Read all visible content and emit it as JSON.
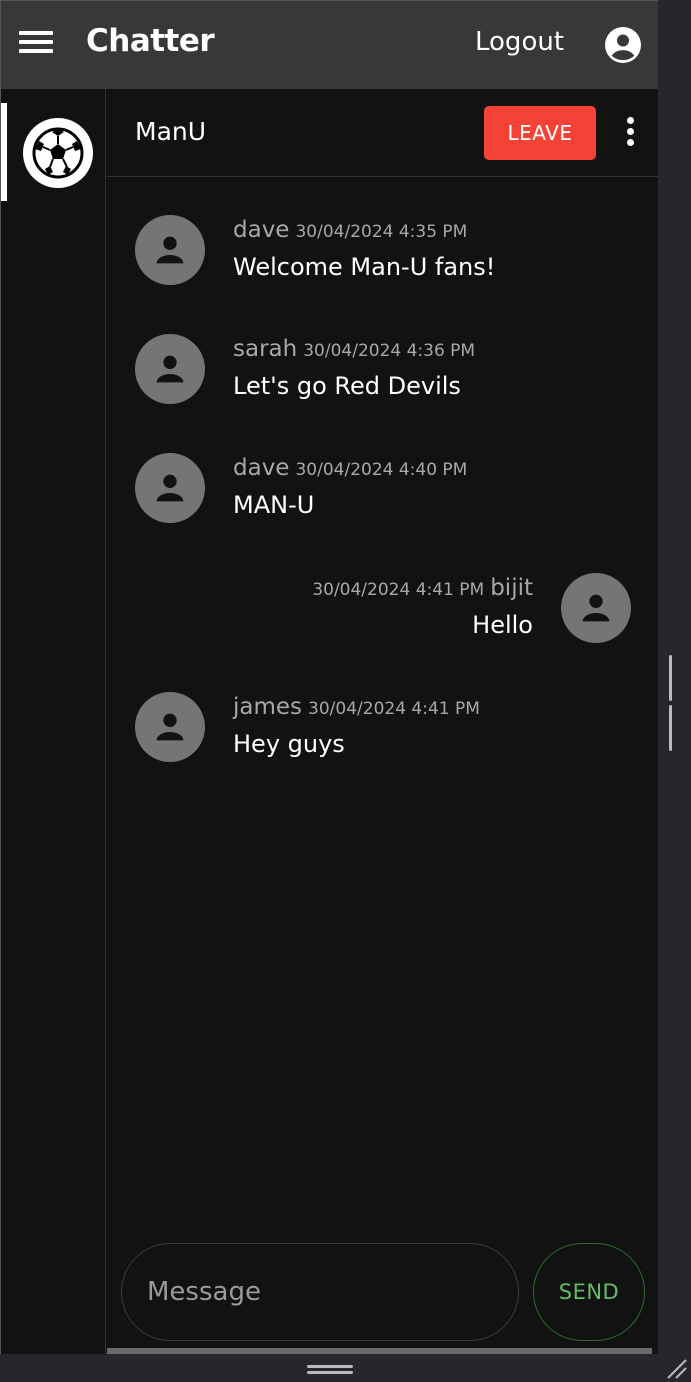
{
  "appbar": {
    "title": "Chatter",
    "logout_label": "Logout"
  },
  "chat": {
    "name": "ManU",
    "leave_label": "LEAVE"
  },
  "messages": [
    {
      "author": "dave",
      "time": "30/04/2024 4:35 PM",
      "text": "Welcome Man-U fans!",
      "own": false
    },
    {
      "author": "sarah",
      "time": "30/04/2024 4:36 PM",
      "text": "Let's go Red Devils",
      "own": false
    },
    {
      "author": "dave",
      "time": "30/04/2024 4:40 PM",
      "text": "MAN-U",
      "own": false
    },
    {
      "author": "bijit",
      "time": "30/04/2024 4:41 PM",
      "text": "Hello",
      "own": true
    },
    {
      "author": "james",
      "time": "30/04/2024 4:41 PM",
      "text": "Hey guys",
      "own": false
    }
  ],
  "composer": {
    "placeholder": "Message",
    "send_label": "SEND"
  },
  "colors": {
    "appbar": "#383838",
    "background": "#121212",
    "leave": "#f44336",
    "send": "#66bb6a",
    "avatar": "#757575"
  },
  "icons": {
    "menu": "hamburger-menu-icon",
    "account": "account-circle-icon",
    "more": "more-vertical-icon",
    "chat": "soccer-ball-icon",
    "person": "person-icon"
  }
}
